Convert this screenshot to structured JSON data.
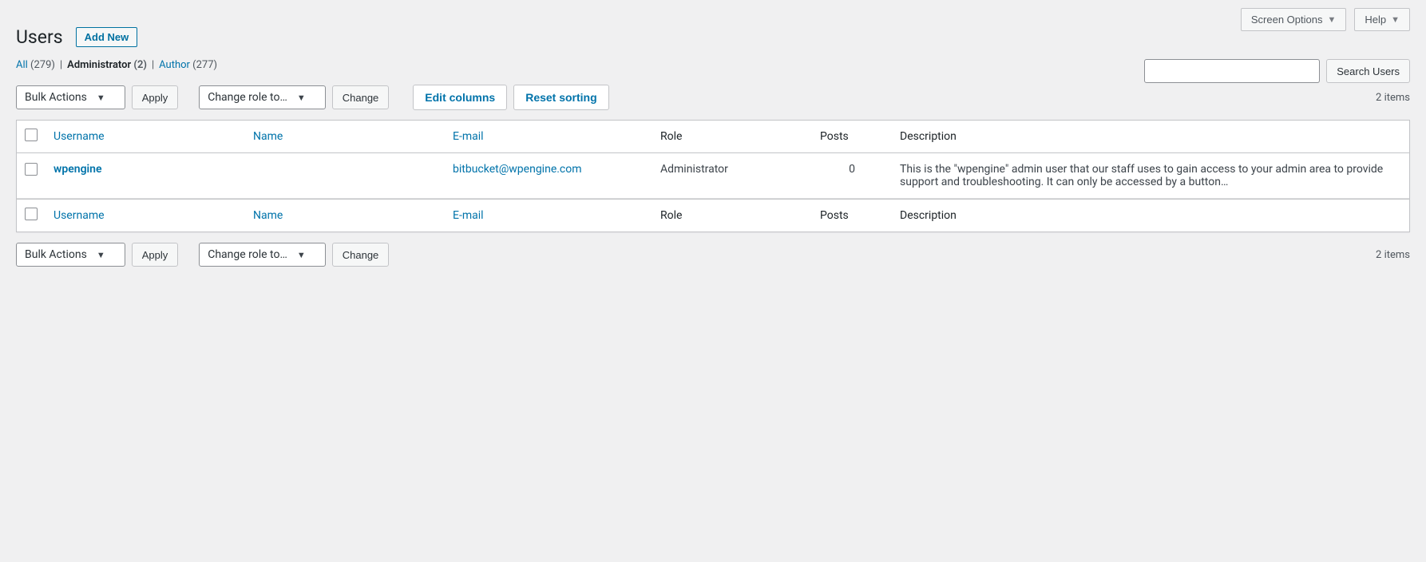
{
  "top": {
    "screen_options": "Screen Options",
    "help": "Help"
  },
  "header": {
    "title": "Users",
    "add_new": "Add New"
  },
  "filters": {
    "all_label": "All",
    "all_count": "(279)",
    "admin_label": "Administrator",
    "admin_count": "(2)",
    "author_label": "Author",
    "author_count": "(277)",
    "sep": "|"
  },
  "search": {
    "button": "Search Users",
    "value": ""
  },
  "bulk": {
    "bulk_label": "Bulk Actions",
    "apply": "Apply",
    "role_label": "Change role to…",
    "change": "Change",
    "edit_columns": "Edit columns",
    "reset_sorting": "Reset sorting",
    "items_count": "2 items"
  },
  "columns": {
    "username": "Username",
    "name": "Name",
    "email": "E-mail",
    "role": "Role",
    "posts": "Posts",
    "description": "Description"
  },
  "rows": [
    {
      "username": "wpengine",
      "name": "",
      "email": "bitbucket@wpengine.com",
      "role": "Administrator",
      "posts": "0",
      "description": "This is the \"wpengine\" admin user that our staff uses to gain access to your admin area to provide support and troubleshooting. It can only be accessed by a button…"
    }
  ]
}
